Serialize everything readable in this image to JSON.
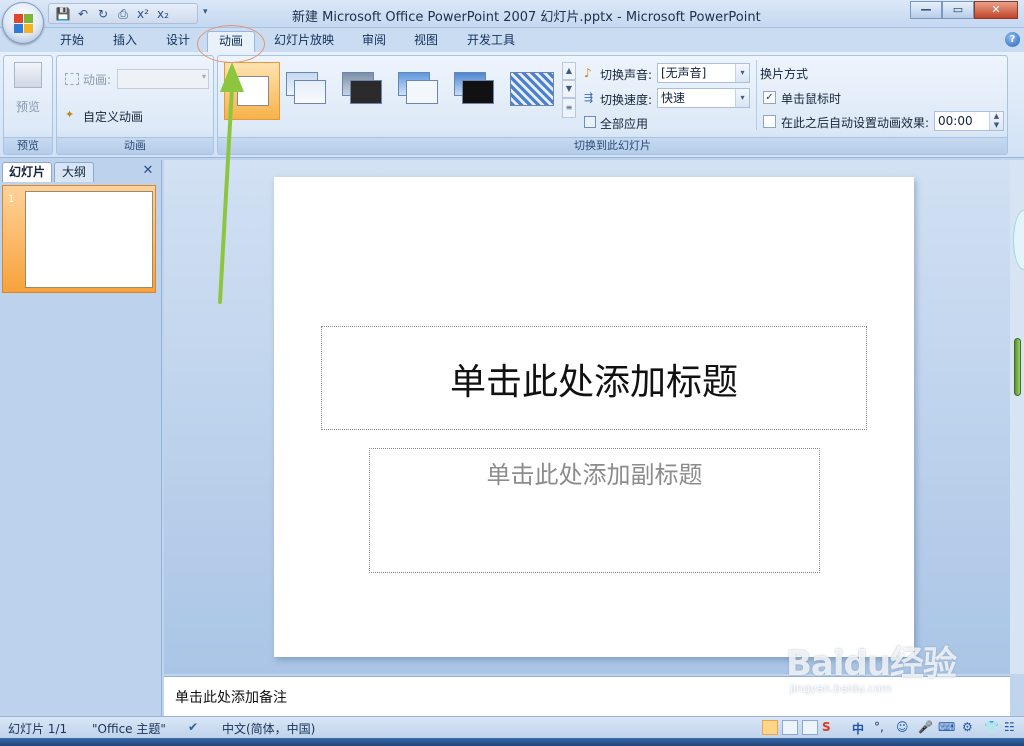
{
  "window": {
    "title": "新建 Microsoft Office PowerPoint 2007 幻灯片.pptx - Microsoft PowerPoint",
    "min_label": "—",
    "max_label": "▭",
    "close_label": "✕"
  },
  "tabs": [
    {
      "label": "开始"
    },
    {
      "label": "插入"
    },
    {
      "label": "设计"
    },
    {
      "label": "动画",
      "active": true
    },
    {
      "label": "幻灯片放映"
    },
    {
      "label": "审阅"
    },
    {
      "label": "视图"
    },
    {
      "label": "开发工具"
    }
  ],
  "ribbon": {
    "preview": {
      "button_label": "预览",
      "group_label": "预览"
    },
    "animation": {
      "animation_label": "动画:",
      "custom_label": "自定义动画",
      "group_label": "动画"
    },
    "transition": {
      "group_label": "切换到此幻灯片",
      "sound_label": "切换声音:",
      "sound_value": "[无声音]",
      "speed_label": "切换速度:",
      "speed_value": "快速",
      "apply_all_label": "全部应用",
      "advance_title": "换片方式",
      "on_click_label": "单击鼠标时",
      "on_click_checked": true,
      "auto_label": "在此之后自动设置动画效果:",
      "auto_checked": false,
      "auto_time": "00:00"
    }
  },
  "left_pane": {
    "tab_slides": "幻灯片",
    "tab_outline": "大纲",
    "slide_number": "1"
  },
  "slide": {
    "title_placeholder": "单击此处添加标题",
    "subtitle_placeholder": "单击此处添加副标题"
  },
  "notes": {
    "placeholder": "单击此处添加备注"
  },
  "status": {
    "slide_info": "幻灯片 1/1",
    "theme": "\"Office 主题\"",
    "language": "中文(简体，中国)"
  },
  "watermark": {
    "text": "Baidu经验",
    "url": "jingyan.baidu.com"
  },
  "colors": {
    "arrow": "#8cc63f",
    "selected_transition": "#f7b24a"
  }
}
